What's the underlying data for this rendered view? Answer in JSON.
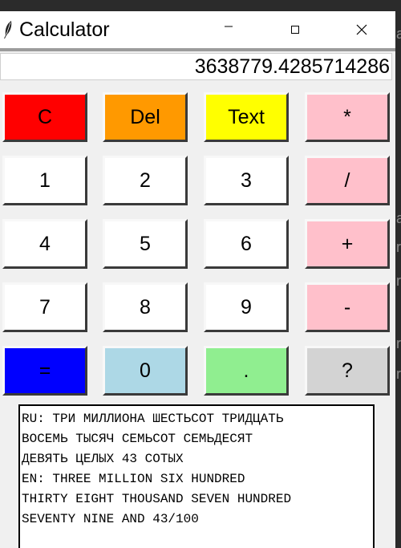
{
  "window": {
    "title": "Calculator",
    "controls": [
      "minimize",
      "maximize",
      "close"
    ]
  },
  "display": {
    "value": "3638779.4285714286"
  },
  "buttons": {
    "clear": {
      "label": "C",
      "color": "#ff0000"
    },
    "delete": {
      "label": "Del",
      "color": "#ff9900"
    },
    "text": {
      "label": "Text",
      "color": "#ffff00"
    },
    "multiply": {
      "label": "*",
      "color": "#ffc0cb"
    },
    "one": {
      "label": "1",
      "color": "#ffffff"
    },
    "two": {
      "label": "2",
      "color": "#ffffff"
    },
    "three": {
      "label": "3",
      "color": "#ffffff"
    },
    "divide": {
      "label": "/",
      "color": "#ffc0cb"
    },
    "four": {
      "label": "4",
      "color": "#ffffff"
    },
    "five": {
      "label": "5",
      "color": "#ffffff"
    },
    "six": {
      "label": "6",
      "color": "#ffffff"
    },
    "plus": {
      "label": "+",
      "color": "#ffc0cb"
    },
    "seven": {
      "label": "7",
      "color": "#ffffff"
    },
    "eight": {
      "label": "8",
      "color": "#ffffff"
    },
    "nine": {
      "label": "9",
      "color": "#ffffff"
    },
    "minus": {
      "label": "-",
      "color": "#ffc0cb"
    },
    "equals": {
      "label": "=",
      "color": "#0000ff"
    },
    "zero": {
      "label": "0",
      "color": "#add8e6"
    },
    "decimal": {
      "label": ".",
      "color": "#90ee90"
    },
    "help": {
      "label": "?",
      "color": "#d3d3d3"
    }
  },
  "output": {
    "lines": [
      "RU: ТРИ МИЛЛИОНА ШЕСТЬСОТ ТРИДЦАТЬ",
      "ВОСЕМЬ ТЫСЯЧ СЕМЬСОТ СЕМЬДЕСЯТ",
      "ДЕВЯТЬ ЦЕЛЫХ 43 СОТЫХ",
      "EN: THREE MILLION SIX HUNDRED",
      "THIRTY EIGHT THOUSAND SEVEN HUNDRED",
      "SEVENTY NINE AND 43/100"
    ]
  },
  "background_window": {
    "letters": [
      "a",
      "r",
      "r",
      "r",
      "r",
      "a"
    ]
  }
}
